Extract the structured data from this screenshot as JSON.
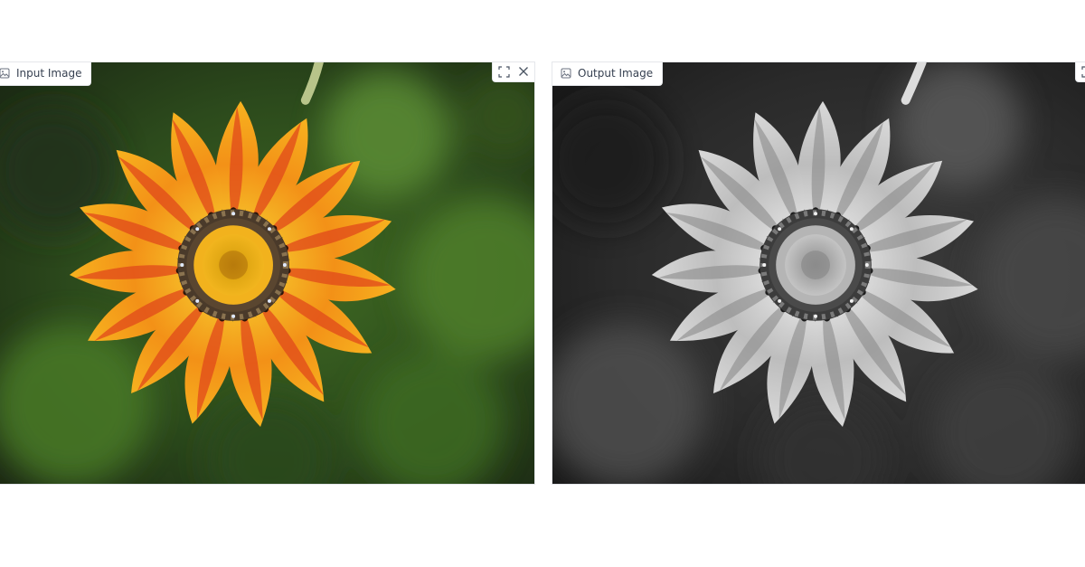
{
  "input_panel": {
    "label": "Input Image",
    "label_icon": "image-icon",
    "tools": [
      "fullscreen-icon",
      "close-icon"
    ]
  },
  "output_panel": {
    "label": "Output Image",
    "label_icon": "image-icon",
    "tools": [
      "fullscreen-icon"
    ]
  },
  "colors": {
    "petal_outer": "#f6a91e",
    "petal_inner": "#e3491a",
    "petal_dark": "#2a1408",
    "center": "#e3a40f",
    "background_green": "#2f4a1f",
    "output_background": "#2b2b2b"
  }
}
